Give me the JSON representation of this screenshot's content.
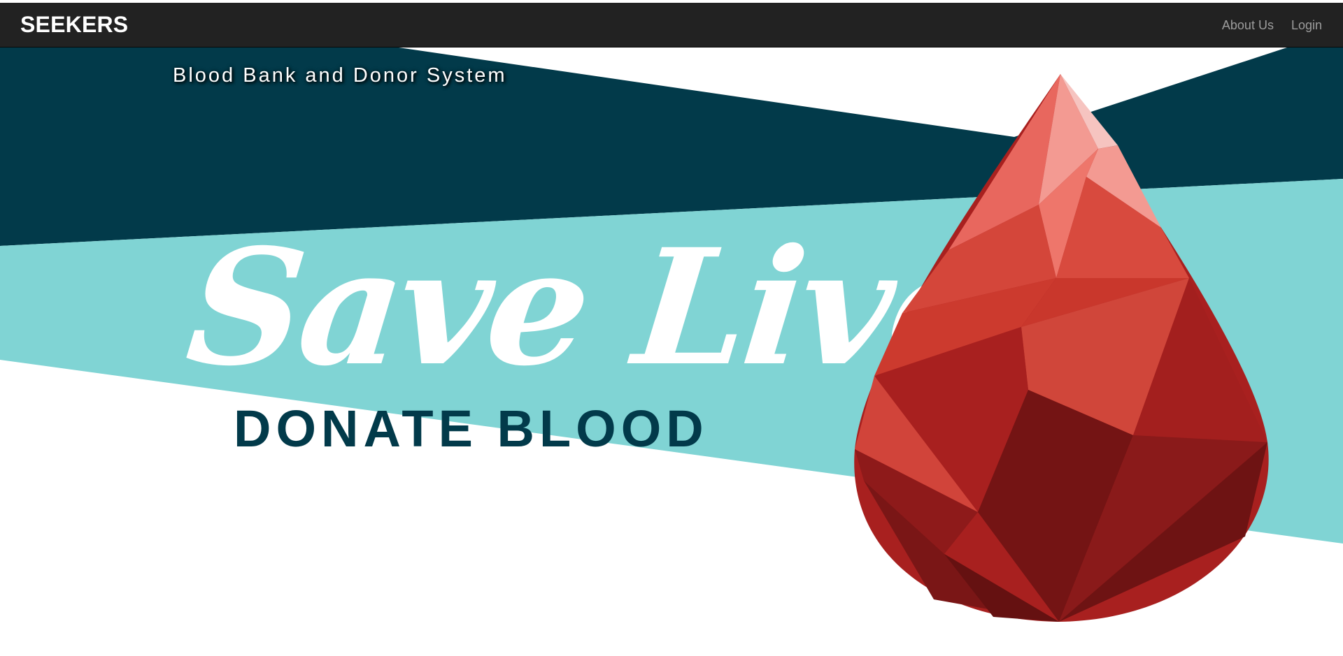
{
  "navbar": {
    "brand": "SEEKERS",
    "links": [
      "About Us",
      "Login"
    ]
  },
  "hero": {
    "tagline": "Blood Bank and Donor System",
    "headline": "Save Lives",
    "subheadline": "DONATE BLOOD"
  },
  "colors": {
    "navbar_bg": "#222222",
    "nav_link": "#9d9d9d",
    "dark_teal": "#023a4a",
    "light_teal": "#80d4d4",
    "blood_red": "#a8201f"
  },
  "icons": {
    "drop": "blood-drop-icon"
  }
}
